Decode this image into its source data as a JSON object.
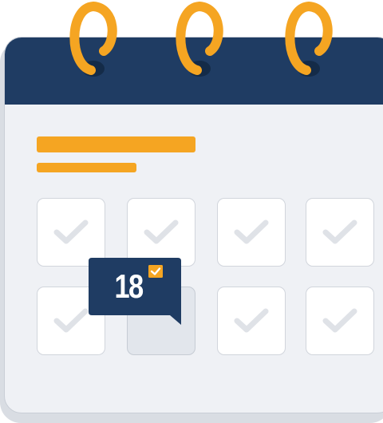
{
  "calendar": {
    "colors": {
      "header": "#1f3c63",
      "ring": "#f5a522",
      "accent_bar": "#f5a522",
      "body": "#eff1f5",
      "cell": "#ffffff",
      "cell_selected": "#e2e6ec",
      "checkmark": "#dfe2e7"
    },
    "rings": [
      "ring-icon",
      "ring-icon",
      "ring-icon"
    ],
    "cells": [
      {
        "icon": "checkmark-icon",
        "selected": false
      },
      {
        "icon": "checkmark-icon",
        "selected": false
      },
      {
        "icon": "checkmark-icon",
        "selected": false
      },
      {
        "icon": "checkmark-icon",
        "selected": false
      },
      {
        "icon": "checkmark-icon",
        "selected": false
      },
      {
        "icon": "",
        "selected": true
      },
      {
        "icon": "checkmark-icon",
        "selected": false
      },
      {
        "icon": "checkmark-icon",
        "selected": false
      }
    ]
  },
  "badge": {
    "day": "18",
    "icon": "checkbox-checked-icon",
    "color": "#1f3c63",
    "check_color": "#f5a522"
  }
}
